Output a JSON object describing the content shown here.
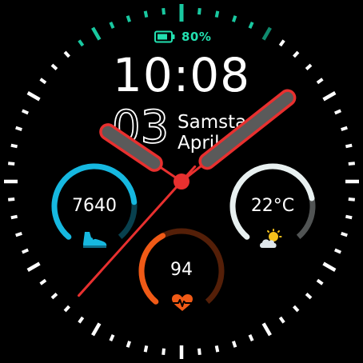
{
  "battery": {
    "percent": "80%",
    "level": 0.8,
    "icon": "battery-icon",
    "color": "#22e0b0"
  },
  "time": {
    "display": "10:08"
  },
  "date": {
    "day": "03",
    "weekday": "Samstag",
    "month": "April"
  },
  "analog": {
    "hours": 10,
    "minutes": 8,
    "seconds": 37,
    "hand_color": "#e8302f"
  },
  "complications": {
    "steps": {
      "value": "7640",
      "icon": "shoe-icon",
      "color": "#16b8e0",
      "progress": 0.8
    },
    "weather": {
      "value": "22°C",
      "icon": "partly-cloudy-icon",
      "color": "#e8f0f0",
      "progress": 0.78
    },
    "heart_rate": {
      "value": "94",
      "icon": "heart-rate-icon",
      "color": "#f05a16",
      "progress": 0.4
    }
  }
}
